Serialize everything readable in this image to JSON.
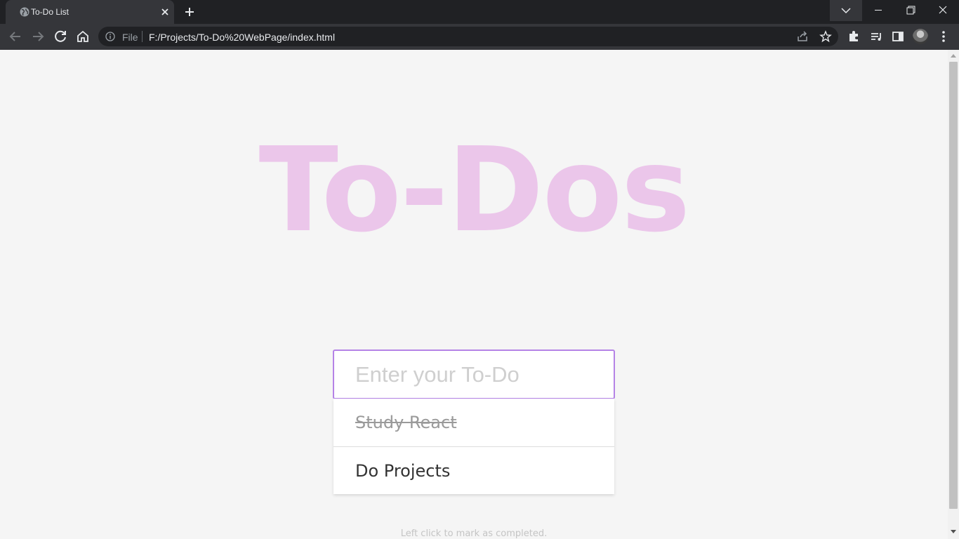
{
  "browser": {
    "tab": {
      "title": "To-Do List",
      "favicon": "globe-icon",
      "close_icon": "close-icon"
    },
    "new_tab_icon": "plus-icon",
    "window_controls": [
      "tab-search-chevron-icon",
      "minimize-icon",
      "restore-icon",
      "close-icon"
    ],
    "toolbar": {
      "back_icon": "arrow-left-icon",
      "forward_icon": "arrow-right-icon",
      "reload_icon": "reload-icon",
      "home_icon": "home-icon"
    },
    "omnibox": {
      "scheme_label": "File",
      "url": "F:/Projects/To-Do%20WebPage/index.html",
      "icons": [
        "share-icon",
        "star-icon"
      ]
    },
    "extensions_icons": [
      "puzzle-icon",
      "media-queue-icon",
      "side-panel-icon",
      "profile-avatar",
      "kebab-menu-icon"
    ]
  },
  "page": {
    "heading": "To-Dos",
    "input_placeholder": "Enter your To-Do",
    "input_value": "",
    "todos": [
      {
        "text": "Study React",
        "completed": true
      },
      {
        "text": "Do Projects",
        "completed": false
      }
    ],
    "hint": "Left click to mark as completed.",
    "colors": {
      "heading": "#ebc6ea",
      "input_border": "#b583e6",
      "background": "#f5f5f5"
    }
  }
}
